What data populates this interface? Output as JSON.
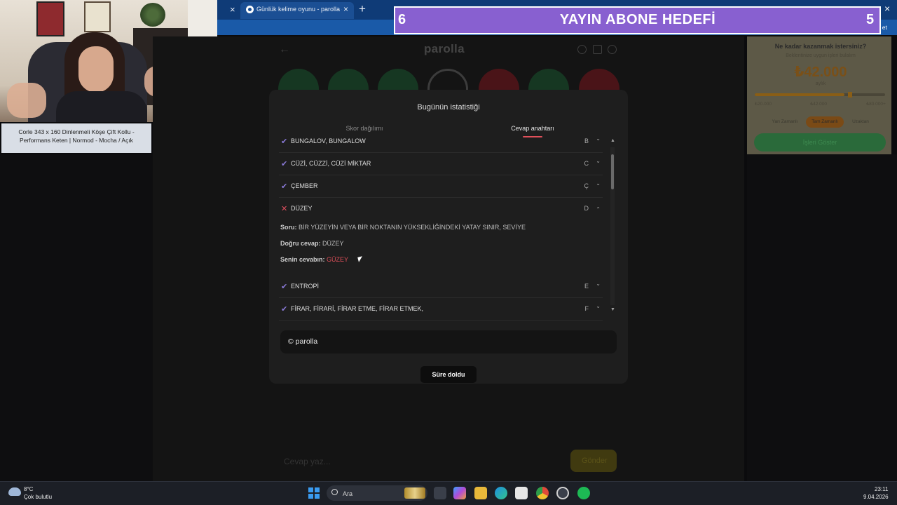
{
  "product_caption": "Corle 343 x 160 Dinlenmeli Köşe Çift Kollu - Performans Keten | Normod - Mocha / Açık",
  "browser": {
    "tab_title": "Günlük kelime oyunu - parolla - K",
    "tab_close": "×",
    "prev_tab_close": "×",
    "new_tab": "+",
    "window_close": "×",
    "address_right_text": "t et"
  },
  "sub_goal": {
    "left": "6",
    "title": "YAYIN ABONE HEDEFİ",
    "right": "5",
    "color": "#8860d0"
  },
  "game": {
    "logo": "parolla",
    "back_icon": "arrow-left-icon",
    "input_placeholder": "Cevap yaz...",
    "submit_label": "Gönder"
  },
  "ad": {
    "title": "Ne kadar kazanmak istersiniz?",
    "subtitle": "Beklentinize uygun işleri bulalım",
    "amount": "₺42.000",
    "period": "aylık",
    "min": "₺20.000",
    "mid": "₺42.000",
    "max": "₺80.000+",
    "pill1": "Yarı Zamanlı",
    "pill2": "Tam Zamanlı",
    "pill3": "Uzaktan",
    "cta": "İşleri Göster"
  },
  "modal": {
    "title": "Bugünün istatistiği",
    "tab_score": "Skor dağılımı",
    "tab_answers": "Cevap anahtarı",
    "rows": [
      {
        "label": "BUNGALOV, BUNGALOW",
        "letter": "B",
        "status": "correct",
        "chevron": "⌄"
      },
      {
        "label": "CÜZİ, CÜZZİ, CÜZİ MİKTAR",
        "letter": "C",
        "status": "correct",
        "chevron": "⌄"
      },
      {
        "label": "ÇEMBER",
        "letter": "Ç",
        "status": "correct",
        "chevron": "⌄"
      },
      {
        "label": "DÜZEY",
        "letter": "D",
        "status": "wrong",
        "chevron": "⌃"
      },
      {
        "label": "ENTROPİ",
        "letter": "E",
        "status": "correct",
        "chevron": "⌄"
      },
      {
        "label": "FİRAR, FİRARİ, FİRAR ETME, FİRAR ETMEK,",
        "letter": "F",
        "status": "correct",
        "chevron": "⌄"
      }
    ],
    "detail": {
      "question_label": "Soru:",
      "question": "BİR YÜZEYİN VEYA BİR NOKTANIN YÜKSEKLİĞİNDEKİ YATAY SINIR, SEVİYE",
      "correct_label": "Doğru cevap:",
      "correct": "DÜZEY",
      "yours_label": "Senin cevabın:",
      "yours": "GÜZEY",
      "yours_color": "#e0505a"
    },
    "brand": "© parolla",
    "time_button": "Süre doldu"
  },
  "taskbar": {
    "temp": "8°C",
    "weather": "Çok bulutlu",
    "search": "Ara",
    "time": "23:11",
    "date": "9.04.2026"
  }
}
